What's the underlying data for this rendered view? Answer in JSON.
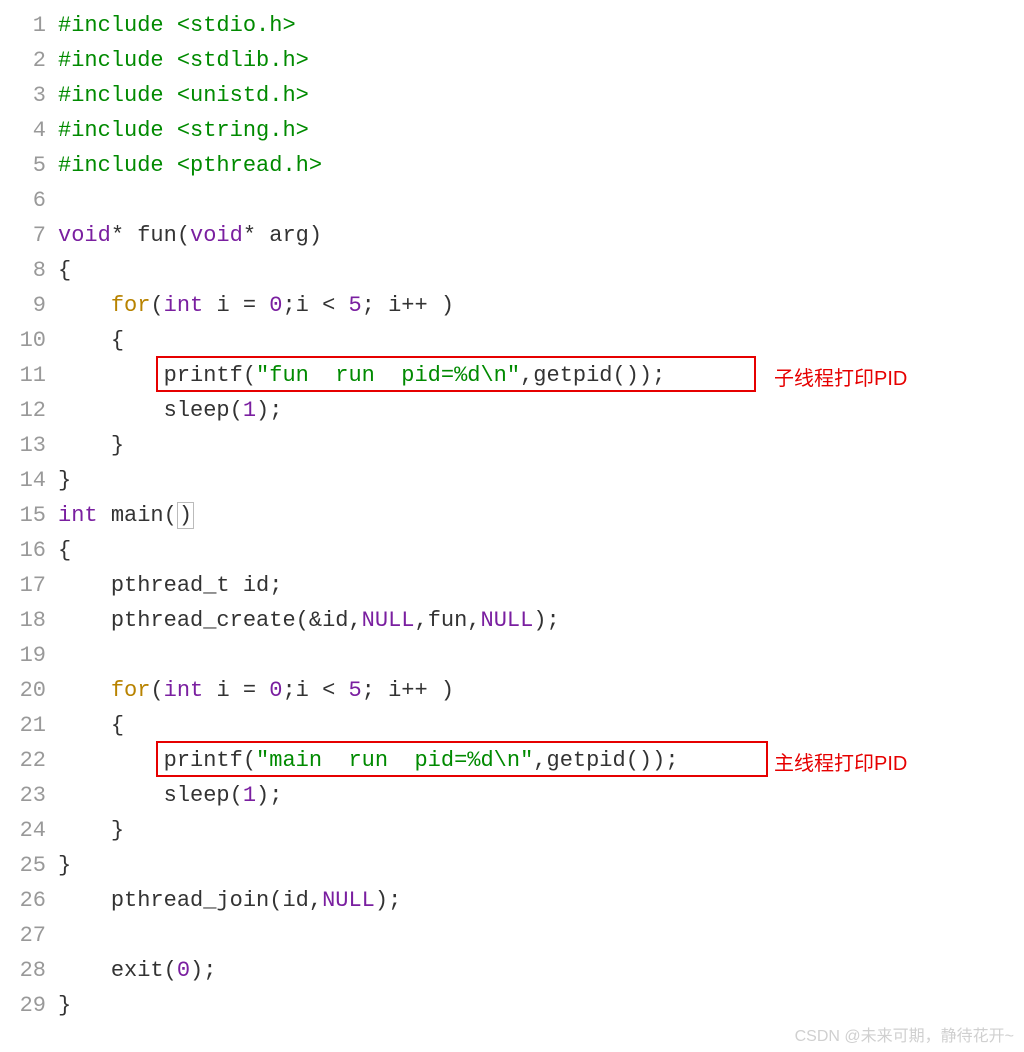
{
  "gutter": [
    "1",
    "2",
    "3",
    "4",
    "5",
    "6",
    "7",
    "8",
    "9",
    "10",
    "11",
    "12",
    "13",
    "14",
    "15",
    "16",
    "17",
    "18",
    "19",
    "20",
    "21",
    "22",
    "23",
    "24",
    "25",
    "26",
    "27",
    "28",
    "29"
  ],
  "tok": {
    "include": "#include",
    "h_stdio": "<stdio.h>",
    "h_stdlib": "<stdlib.h>",
    "h_unistd": "<unistd.h>",
    "h_string": "<string.h>",
    "h_pthread": "<pthread.h>",
    "void": "void",
    "star": "*",
    "fun": "fun",
    "arg": "arg",
    "lbrace": "{",
    "rbrace": "}",
    "for": "for",
    "int": "int",
    "i": "i",
    "eq": "=",
    "zero": "0",
    "five": "5",
    "lt": "<",
    "inc": "++",
    "semi": ";",
    "comma": ",",
    "lp": "(",
    "rp": ")",
    "printf": "printf",
    "sleep": "sleep",
    "one": "1",
    "main": "main",
    "pthread_t": "pthread_t",
    "id": "id",
    "pthread_create": "pthread_create",
    "amp": "&",
    "NULL": "NULL",
    "pthread_join": "pthread_join",
    "exit": "exit",
    "getpid": "getpid",
    "str_fun": "\"fun  run  pid=%d\\n\"",
    "str_main": "\"main  run  pid=%d\\n\""
  },
  "annotations": {
    "child": "子线程打印PID",
    "main": "主线程打印PID"
  },
  "watermark": "CSDN @未来可期，静待花开~"
}
